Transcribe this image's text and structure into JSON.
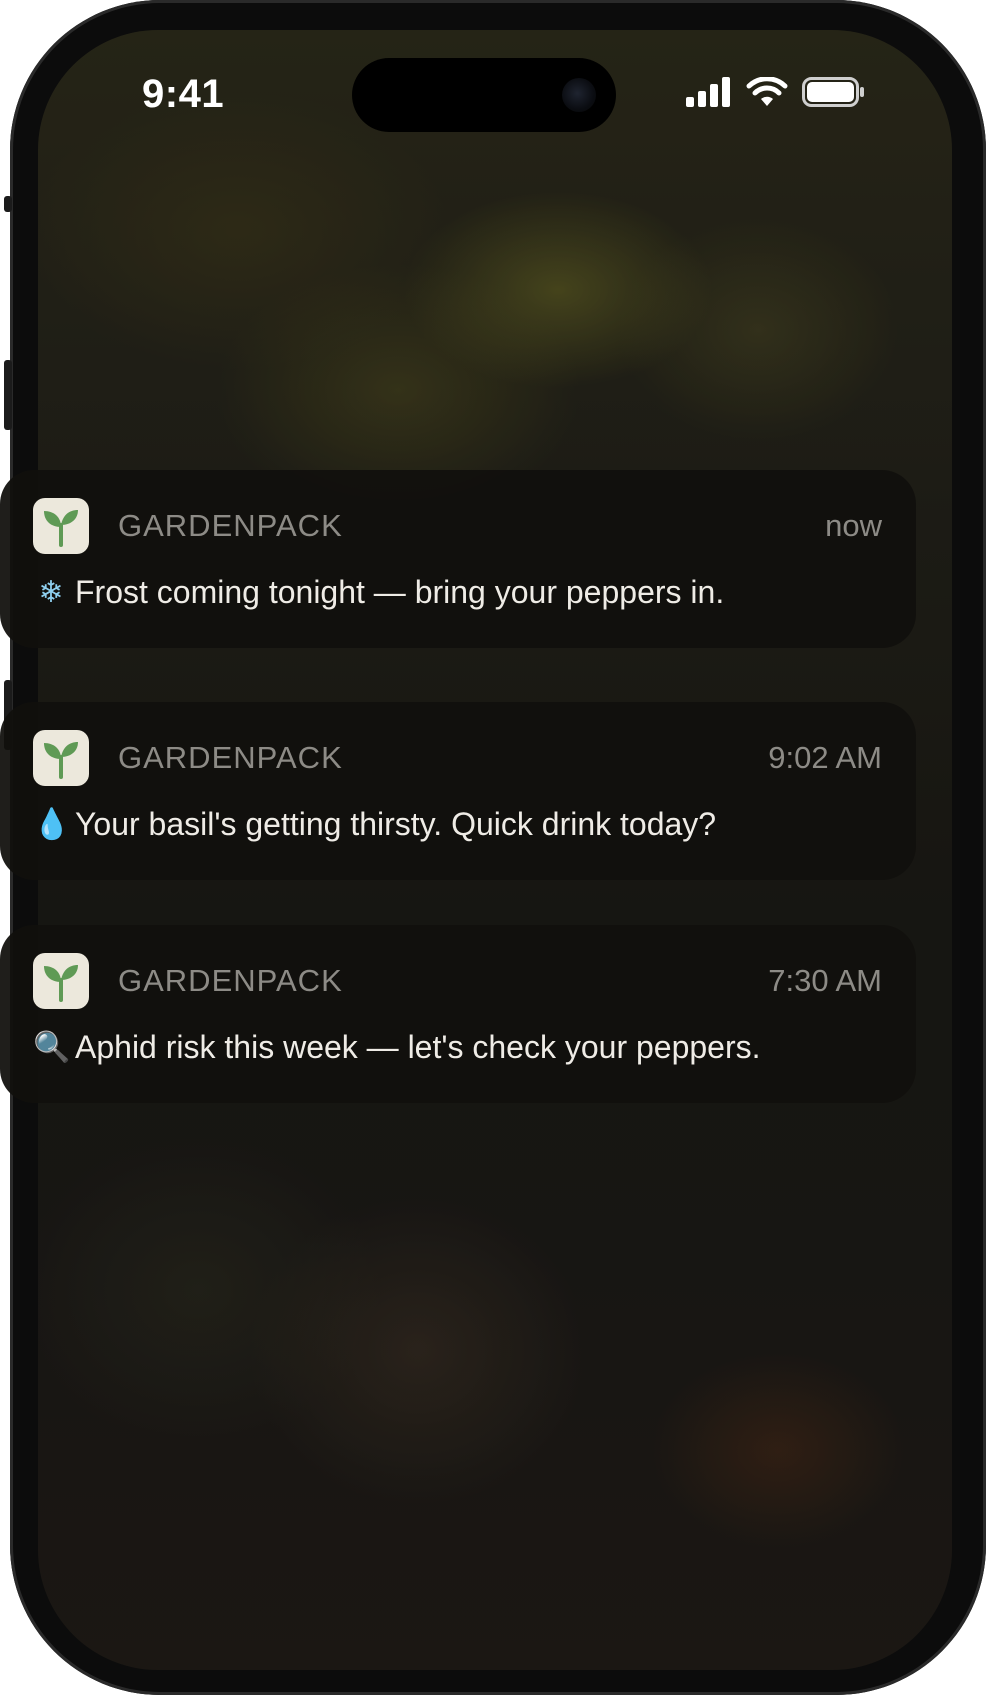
{
  "status_bar": {
    "time": "9:41",
    "icons": [
      "cellular-signal-icon",
      "wifi-icon",
      "battery-icon"
    ]
  },
  "notifications": [
    {
      "app_name": "GARDENPACK",
      "time": "now",
      "icon": "snowflake-icon",
      "emoji": "❄",
      "message": "Frost coming tonight — bring your peppers in."
    },
    {
      "app_name": "GARDENPACK",
      "time": "9:02 AM",
      "icon": "water-drop-icon",
      "emoji": "💧",
      "message": "Your basil's getting thirsty. Quick drink today?"
    },
    {
      "app_name": "GARDENPACK",
      "time": "7:30 AM",
      "icon": "magnifying-glass-icon",
      "emoji": "🔍",
      "message": "Aphid risk this week — let's check your peppers."
    }
  ],
  "colors": {
    "notification_bg": "#11100d",
    "app_icon_bg": "#ece8dc",
    "sprout_green": "#5f9a55",
    "snowflake_blue": "#8fd0f0",
    "drop_blue": "#4aa8e8"
  }
}
